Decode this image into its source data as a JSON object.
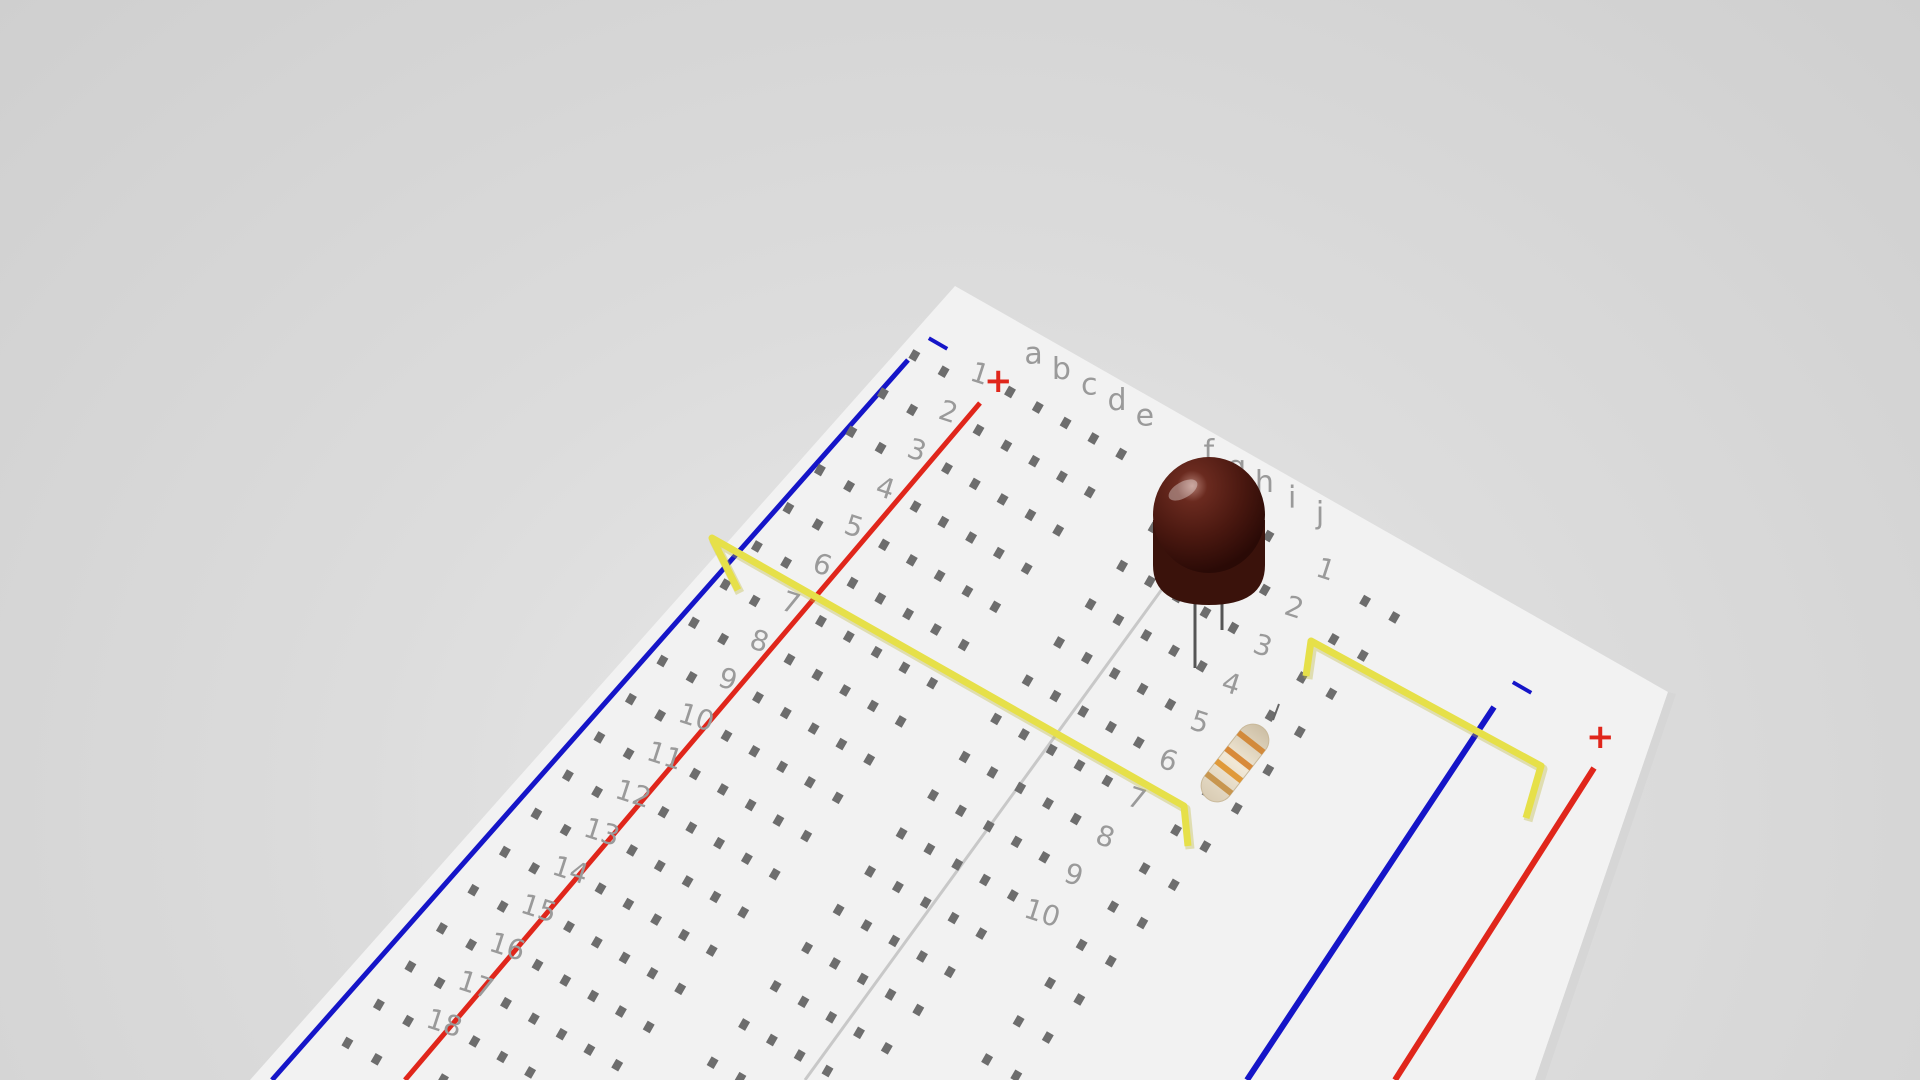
{
  "scene": {
    "description_free": true,
    "colors": {
      "background": "#d8d8d8",
      "board": "#f2f2f2",
      "rail_negative": "#1515c8",
      "rail_positive": "#e0261b",
      "jumper_wire": "#e6e049",
      "led_body": "#4a1a12",
      "resistor_body": "#e8dcc6"
    }
  },
  "breadboard": {
    "left_rail": {
      "negative_sign": "−",
      "positive_sign": "+"
    },
    "right_rail": {
      "negative_sign": "−",
      "positive_sign": "+"
    },
    "columns": [
      "a",
      "b",
      "c",
      "d",
      "e",
      "f",
      "g",
      "h",
      "i",
      "j"
    ],
    "left_row_numbers": [
      "1",
      "2",
      "3",
      "4",
      "5",
      "6",
      "7",
      "8",
      "9",
      "10",
      "11",
      "12",
      "13",
      "14",
      "15",
      "16",
      "17",
      "18"
    ],
    "right_row_numbers": [
      "1",
      "2",
      "3",
      "4",
      "5",
      "6",
      "7",
      "8",
      "9",
      "10"
    ]
  },
  "components": [
    {
      "type": "led",
      "icon": "led-icon"
    },
    {
      "type": "resistor",
      "icon": "resistor-icon"
    },
    {
      "type": "jumper-wire",
      "icon": "wire-icon"
    },
    {
      "type": "jumper-wire",
      "icon": "wire-icon"
    }
  ]
}
